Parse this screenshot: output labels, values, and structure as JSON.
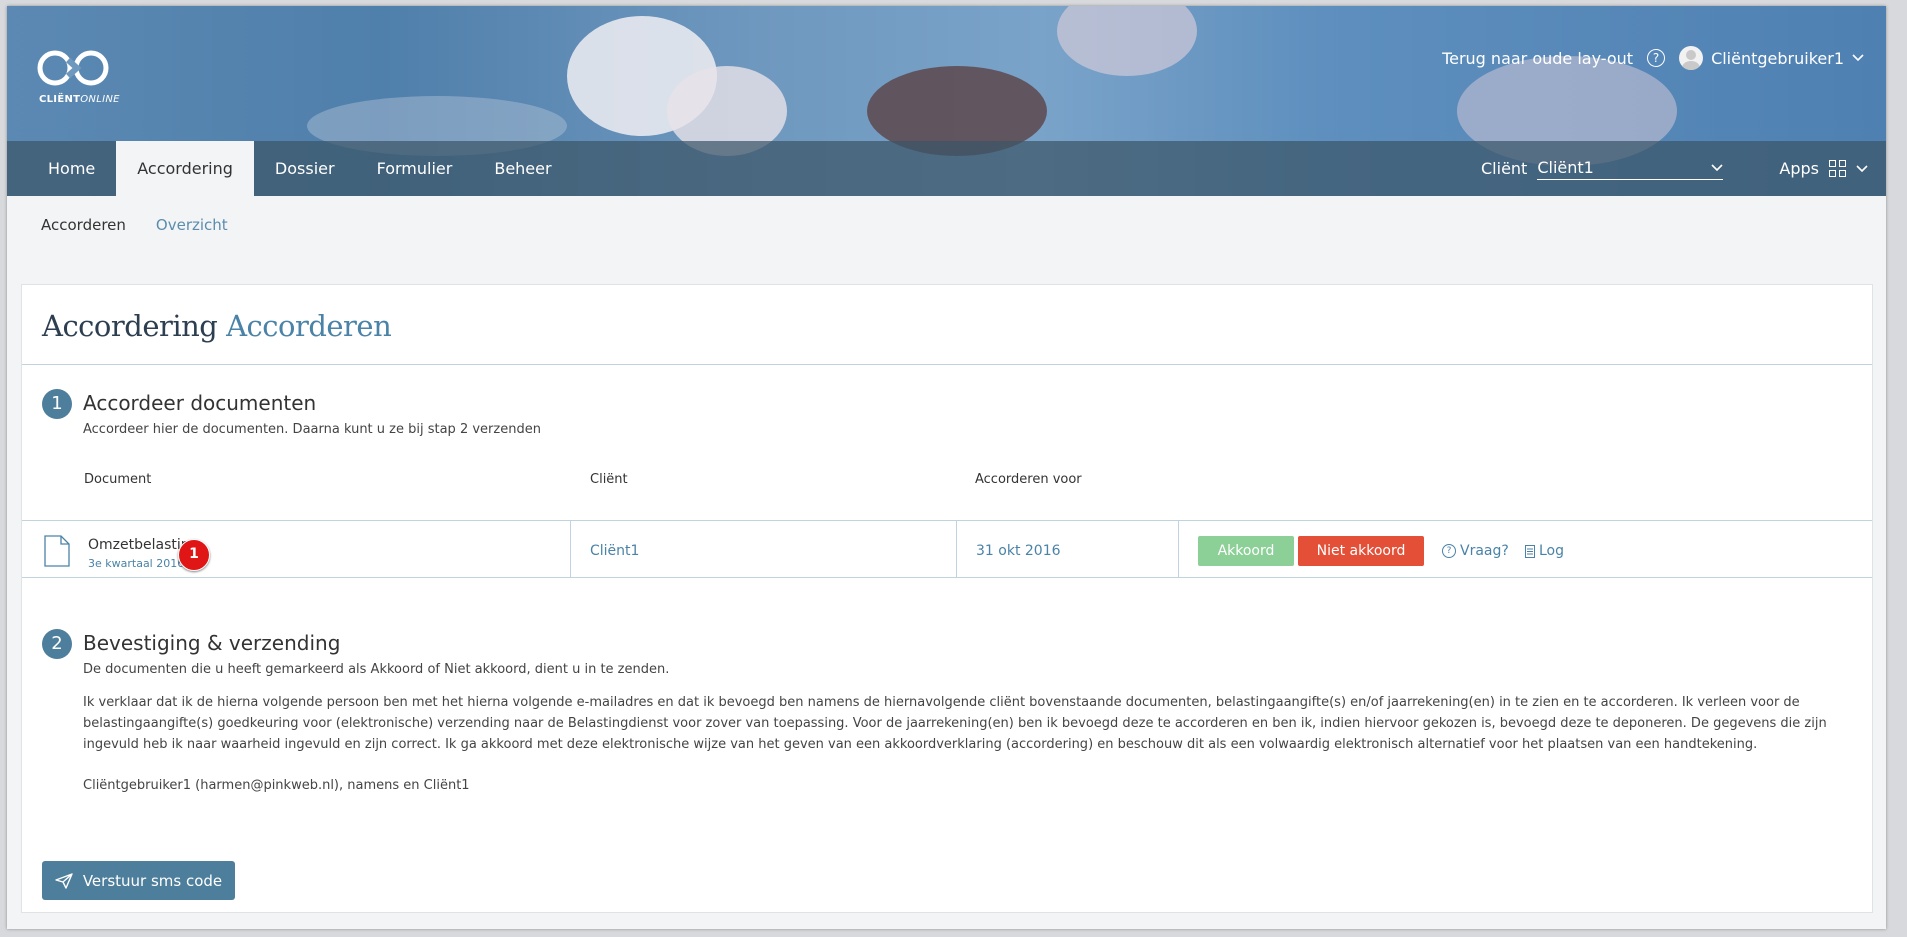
{
  "header": {
    "logo_text_bold": "CLIËNT",
    "logo_text_italic": "ONLINE",
    "back_link": "Terug naar oude lay-out",
    "help_icon": "?",
    "user_name": "Cliëntgebruiker1",
    "dropdown_glyph": "⌄"
  },
  "nav": {
    "items": [
      {
        "label": "Home"
      },
      {
        "label": "Accordering"
      },
      {
        "label": "Dossier"
      },
      {
        "label": "Formulier"
      },
      {
        "label": "Beheer"
      }
    ],
    "active_index": 1,
    "client_label": "Cliënt",
    "client_value": "Cliënt1",
    "apps_label": "Apps"
  },
  "subnav": {
    "current": "Accorderen",
    "link": "Overzicht"
  },
  "card": {
    "title_main": "Accordering",
    "title_accent": "Accorderen"
  },
  "step1": {
    "number": "1",
    "title": "Accordeer documenten",
    "subtitle": "Accordeer hier de documenten. Daarna kunt u ze bij stap 2 verzenden",
    "columns": [
      "Document",
      "Cliënt",
      "Accorderen voor"
    ],
    "row": {
      "document": "Omzetbelasting",
      "period": "3e kwartaal 2016",
      "badge": "1",
      "client": "Cliënt1",
      "date": "31 okt 2016",
      "approve": "Akkoord",
      "reject": "Niet akkoord",
      "question": "Vraag?",
      "log": "Log"
    }
  },
  "step2": {
    "number": "2",
    "title": "Bevestiging & verzending",
    "subtitle": "De documenten die u heeft gemarkeerd als Akkoord of Niet akkoord, dient u in te zenden.",
    "declaration": "Ik verklaar dat ik de hierna volgende persoon ben met het hierna volgende e-mailadres en dat ik bevoegd ben namens de hiernavolgende cliënt bovenstaande documenten, belastingaangifte(s) en/of jaarrekening(en) in te zien en te accorderen. Ik verleen voor de belastingaangifte(s) goedkeuring voor (elektronische) verzending naar de Belastingdienst voor zover van toepassing. Voor de jaarrekening(en) ben ik bevoegd deze te accorderen en ben ik, indien hiervoor gekozen is, bevoegd deze te deponeren. De gegevens die zijn ingevuld heb ik naar waarheid ingevuld en zijn correct. Ik ga akkoord met deze elektronische wijze van het geven van een akkoordverklaring (accordering) en beschouw dit als een volwaardig elektronisch alternatief voor het plaatsen van een handtekening.",
    "signer": "Cliëntgebruiker1 (harmen@pinkweb.nl), namens en Cliënt1",
    "send_button": "Verstuur sms code"
  },
  "colors": {
    "accent": "#4a83a7",
    "step_badge": "#4d7e9c",
    "approve": "#8ccf97",
    "reject": "#e34f37",
    "notification": "#e01515"
  }
}
